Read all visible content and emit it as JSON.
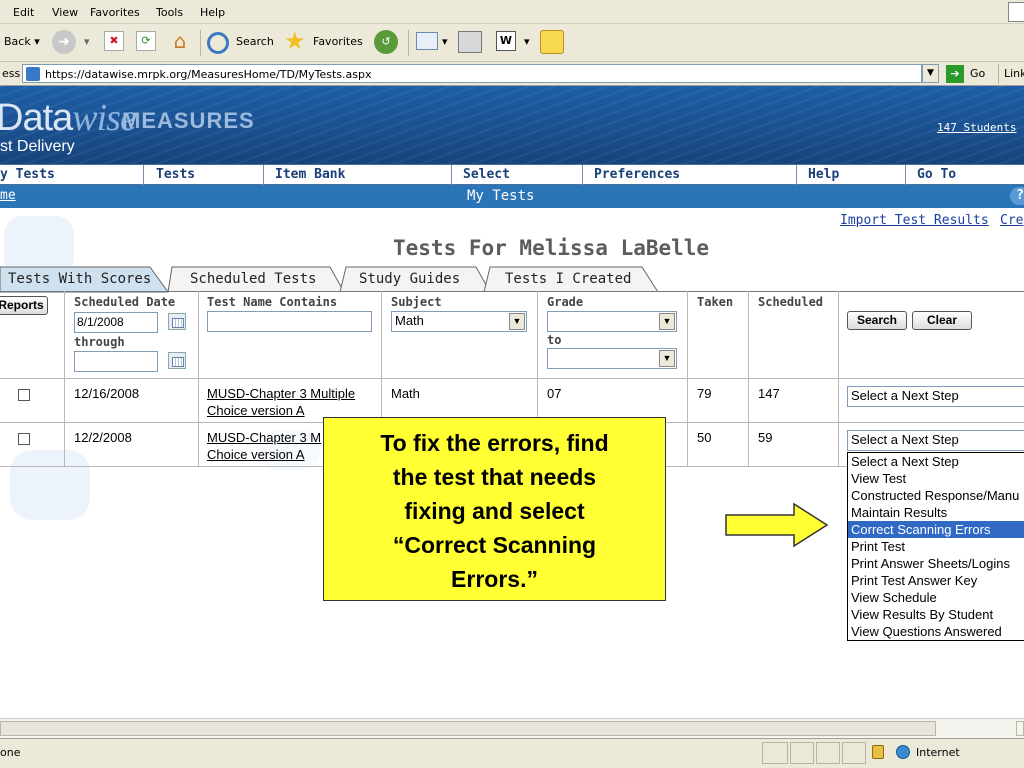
{
  "browser": {
    "menu": [
      "Edit",
      "View",
      "Favorites",
      "Tools",
      "Help"
    ],
    "toolbar": {
      "back": "Back",
      "search": "Search",
      "favorites": "Favorites"
    },
    "address": {
      "label": "ess",
      "url": "https://datawise.mrpk.org/MeasuresHome/TD/MyTests.aspx",
      "go": "Go",
      "links": "Link"
    },
    "status": {
      "text": "one",
      "zone": "Internet"
    }
  },
  "banner": {
    "logo_main": "Data",
    "logo_script": "wise",
    "logo_measures": "MEASURES",
    "subtitle": "st Delivery",
    "students_link": "147 Students"
  },
  "nav": [
    "y Tests",
    "Tests",
    "Item Bank",
    "Select",
    "Preferences",
    "Help",
    "Go To"
  ],
  "subnav": {
    "home": "me",
    "title": "My Tests",
    "help": "?"
  },
  "top_links": {
    "import": "Import Test Results",
    "create": "Cre"
  },
  "page_title": "Tests For Melissa LaBelle",
  "tabs": [
    {
      "label": "Tests With Scores",
      "active": true
    },
    {
      "label": "Scheduled Tests",
      "active": false
    },
    {
      "label": "Study Guides",
      "active": false
    },
    {
      "label": "Tests I Created",
      "active": false
    }
  ],
  "filters": {
    "reports_button": "Reports",
    "scheduled_date_label": "Scheduled Date",
    "date_from": "8/1/2008",
    "through_label": "through",
    "date_to": "",
    "test_name_label": "Test Name Contains",
    "test_name_value": "",
    "subject_label": "Subject",
    "subject_value": "Math",
    "grade_label": "Grade",
    "grade_from": "",
    "to_label": "to",
    "grade_to": "",
    "taken_label": "Taken",
    "scheduled_label": "Scheduled",
    "search_button": "Search",
    "clear_button": "Clear"
  },
  "rows": [
    {
      "date": "12/16/2008",
      "name_line1": "MUSD-Chapter 3 Multiple",
      "name_line2": "Choice version A",
      "subject": "Math",
      "grade": "07",
      "taken": "79",
      "scheduled": "147",
      "next_step": "Select a Next Step"
    },
    {
      "date": "12/2/2008",
      "name_line1": "MUSD-Chapter 3 M",
      "name_line2": "Choice version A",
      "subject": "",
      "grade": "",
      "taken": "50",
      "scheduled": "59",
      "next_step": "Select a Next Step"
    }
  ],
  "dropdown_options": [
    "Select a Next Step",
    "View Test",
    "Constructed Response/Manu",
    "Maintain Results",
    "Correct Scanning Errors",
    "Print Test",
    "Print Answer Sheets/Logins",
    "Print Test Answer Key",
    "View Schedule",
    "View Results By Student",
    "View Questions Answered"
  ],
  "dropdown_selected_index": 4,
  "callout": {
    "lines": [
      "To fix the errors, find",
      "the test that needs",
      "fixing and select",
      "“Correct Scanning",
      "Errors.”"
    ],
    "color": "#ffff33"
  },
  "colors": {
    "banner": "#1c5fa6",
    "subbar": "#2a74b8",
    "selection": "#316ac5",
    "callout": "#ffff33"
  }
}
